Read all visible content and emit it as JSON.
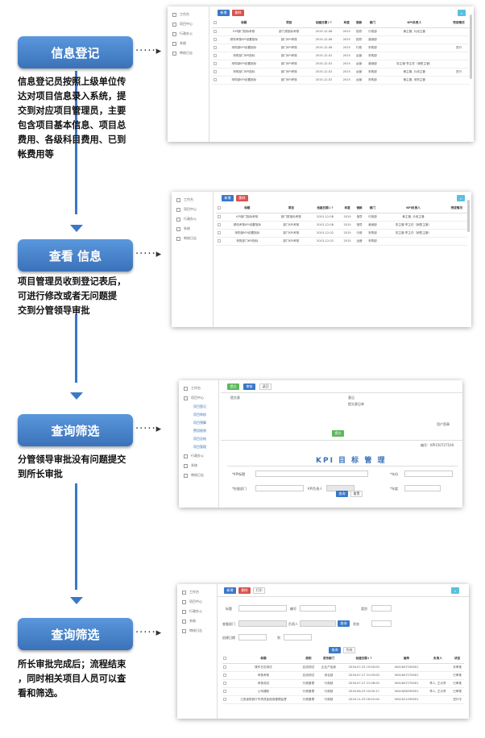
{
  "steps": [
    {
      "label": "信息登记",
      "desc_lines": [
        "信息登记员按照上级单位传",
        "达对项目信息录入系统，提",
        "交到对应项目管理员，主要",
        "包含项目基本信息、项目总",
        "费用、各级科目费用、已到",
        "帐费用等"
      ]
    },
    {
      "label": "查看 信息",
      "desc_lines": [
        "项目管理员收到登记表后，",
        "可进行修改或者无问题提",
        "交到分管领导审批"
      ]
    },
    {
      "label": "查询筛选",
      "desc_lines": [
        "分管领导审批没有问题提交",
        "到所长审批"
      ]
    },
    {
      "label": "查询筛选",
      "desc_lines": [
        "所长审批完成后；流程结束",
        "，同时相关项目人员可以查",
        "看和筛选。"
      ]
    }
  ],
  "connector": "·····▸",
  "sidebar": [
    "工作台",
    "项目中心",
    "行政办公",
    "系统",
    "审核日志"
  ],
  "sidebar_sub": [
    "项目登记",
    "项目审核",
    "项目预算",
    "费用报销",
    "项目总结",
    "项目管理"
  ],
  "buttons": {
    "add": "新增",
    "delete": "删除",
    "print": "打印",
    "submit": "提交",
    "search": "查询",
    "reset": "重置",
    "save": "保存",
    "query": "查询",
    "tab_main": "首页",
    "tab_done": "完成"
  },
  "grid": {
    "headers": [
      "",
      "标题",
      "项目",
      "创建日期↓↑",
      "年度",
      "借款",
      "部门",
      "KPI负责人",
      "完成情况"
    ],
    "rows1": [
      [
        "",
        "KPI部门指标考核",
        "部门类指标考核",
        "2015-12-08",
        "2015",
        "指导",
        "行政部",
        "黄主管, 片段主管",
        ""
      ],
      [
        "",
        "绩效考核KPI设置指标",
        "部门KPI考核",
        "2015-12-08",
        "2015",
        "指导",
        "营销部",
        "",
        ""
      ],
      [
        "",
        "采购部KPI设置指标",
        "部门KPI考核",
        "2015-12-08",
        "2015",
        "行政",
        "采购部",
        "",
        "进行"
      ],
      [
        "",
        "采购部门KPI指标",
        "部门KPI考核",
        "2015-12-02",
        "2015",
        "运营",
        "采购部",
        "",
        ""
      ],
      [
        "",
        "采购部KPI设置指标",
        "部门KPI考核",
        "2015-12-02",
        "2015",
        "运营",
        "营销部",
        "张主管·李主任（销售主管）",
        ""
      ],
      [
        "",
        "采购部门KPI指标",
        "部门KPI考核",
        "2015-12-02",
        "2015",
        "运营",
        "采购部",
        "黄主管, 片段主管",
        "进行"
      ],
      [
        "",
        "采购部KPI设置指标",
        "部门KPI考核",
        "2015-12-02",
        "2015",
        "运营",
        "采购部",
        "黄主管, 采购主管",
        ""
      ]
    ],
    "rows2": [
      [
        "",
        "KPI部门指标考核",
        "部门类指标考核",
        "2015-12-08",
        "2015",
        "指导",
        "行政部",
        "黄主管, 片段主管",
        ""
      ],
      [
        "",
        "绩效考核KPI设置指标",
        "部门KPI考核",
        "2015-12-08",
        "2015",
        "指导",
        "营销部",
        "张主管·李主任（销售主管）",
        ""
      ],
      [
        "",
        "采购部KPI设置指标",
        "部门KPI考核",
        "2015-12-02",
        "2015",
        "行政",
        "采购部",
        "张主管·李主任（销售主管）",
        ""
      ],
      [
        "",
        "采购部门KPI指标",
        "部门KPI考核",
        "2015-12-02",
        "2015",
        "运营",
        "采购部",
        "",
        ""
      ]
    ]
  },
  "form3": {
    "tabs": [
      "提交",
      "审核",
      "返回"
    ],
    "left_title": "提交意",
    "right_title": "意见",
    "right_hint": "提交意见单",
    "number": "编号：KPI150727100",
    "kpi_title": "KPI 目 标 管 理",
    "fields": [
      "*KPI标题",
      "*年份",
      "*检查部门",
      "KPI负责人",
      "*年度"
    ],
    "sign_label": "用户签章"
  },
  "form4": {
    "fields": [
      "标题",
      "编号",
      "类别",
      "查看部门",
      "负责人",
      "状态",
      "创建日期",
      "到"
    ],
    "headers": [
      "",
      "标题",
      "类别",
      "发布部门",
      "创建日期↓↑",
      "编号",
      "负责人",
      "状态"
    ],
    "rows": [
      [
        "",
        "操作日志测试",
        "应用测试",
        "企业产品部",
        "2016-07-25 19:00:00",
        "0041607250001",
        "",
        "未审核"
      ],
      [
        "",
        "考核考核",
        "应用测试",
        "综合部",
        "2016-07-27 21:09:00",
        "0041607270001",
        "",
        "已审核"
      ],
      [
        "",
        "考核测试",
        "行政管理",
        "行政部",
        "2016-07-27 21:08:00",
        "0041607270001",
        "李人, 王大李",
        "已审核"
      ],
      [
        "",
        "公司通知",
        "行政管理",
        "行政部",
        "2016-06-29 10:00:17",
        "0041606290001",
        "李人, 王大李",
        "已审核"
      ],
      [
        "",
        "江西省财政厅专项资金使用管理监督",
        "行政管理",
        "行政部",
        "2016-11-29 16:02:04",
        "0041611290001",
        "",
        "进行中"
      ]
    ]
  }
}
